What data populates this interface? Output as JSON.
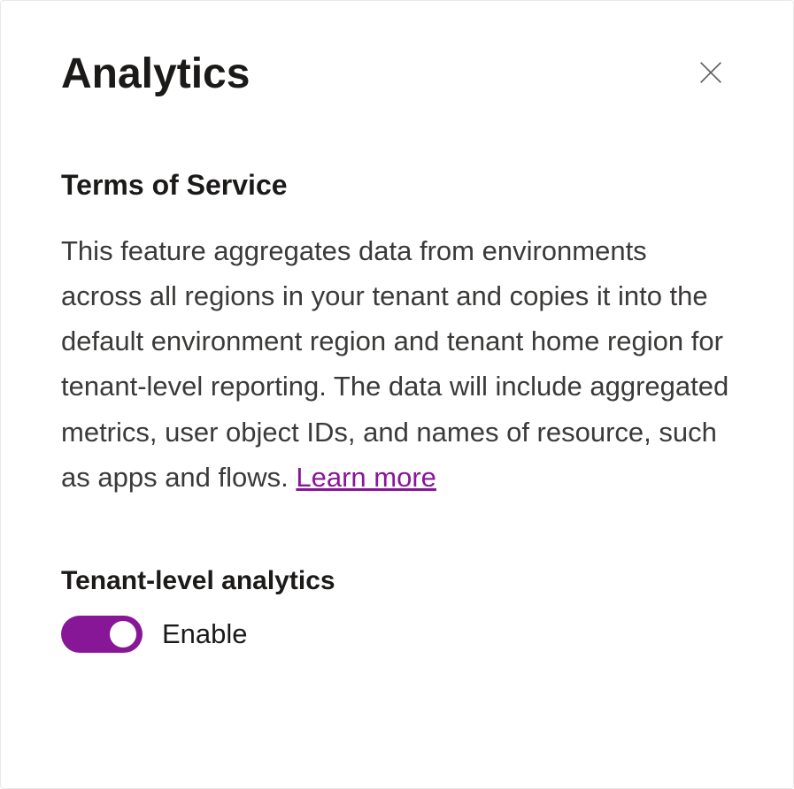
{
  "panel": {
    "title": "Analytics"
  },
  "terms": {
    "heading": "Terms of Service",
    "body": "This feature aggregates data from environments across all regions in your tenant and copies it into the default environment region and tenant home region for tenant-level reporting. The data will include aggregated metrics, user object IDs, and names of resource, such as apps and flows. ",
    "learn_more": "Learn more"
  },
  "toggle": {
    "heading": "Tenant-level analytics",
    "label": "Enable"
  }
}
